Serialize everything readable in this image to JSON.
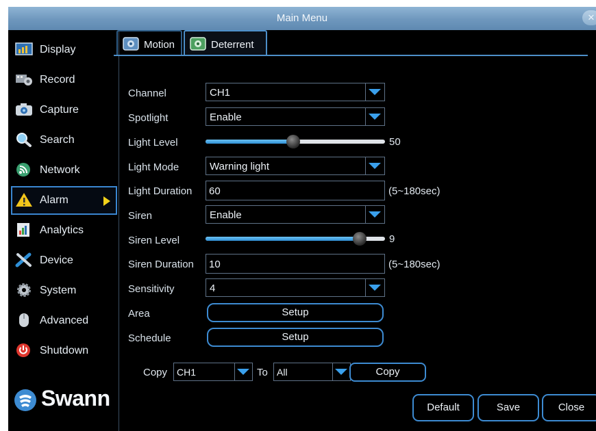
{
  "window": {
    "title": "Main Menu",
    "close_icon": "close-icon"
  },
  "sidebar": {
    "items": [
      {
        "label": "Display",
        "icon": "display-icon"
      },
      {
        "label": "Record",
        "icon": "record-icon"
      },
      {
        "label": "Capture",
        "icon": "camera-icon"
      },
      {
        "label": "Search",
        "icon": "search-icon"
      },
      {
        "label": "Network",
        "icon": "network-icon"
      },
      {
        "label": "Alarm",
        "icon": "warning-icon",
        "active": true
      },
      {
        "label": "Analytics",
        "icon": "analytics-icon"
      },
      {
        "label": "Device",
        "icon": "tools-icon"
      },
      {
        "label": "System",
        "icon": "gear-icon"
      },
      {
        "label": "Advanced",
        "icon": "mouse-icon"
      },
      {
        "label": "Shutdown",
        "icon": "power-icon"
      }
    ],
    "logo": "Swann"
  },
  "tabs": [
    {
      "label": "Motion",
      "icon": "motion-camera-icon"
    },
    {
      "label": "Deterrent",
      "icon": "deterrent-camera-icon",
      "active": true
    }
  ],
  "form": {
    "channel": {
      "label": "Channel",
      "value": "CH1"
    },
    "spotlight": {
      "label": "Spotlight",
      "value": "Enable"
    },
    "light_level": {
      "label": "Light Level",
      "value": "50",
      "fraction": 0.49
    },
    "light_mode": {
      "label": "Light Mode",
      "value": "Warning light"
    },
    "light_duration": {
      "label": "Light Duration",
      "value": "60",
      "hint": "(5~180sec)"
    },
    "siren": {
      "label": "Siren",
      "value": "Enable"
    },
    "siren_level": {
      "label": "Siren Level",
      "value": "9",
      "fraction": 0.86
    },
    "siren_duration": {
      "label": "Siren Duration",
      "value": "10",
      "hint": "(5~180sec)"
    },
    "sensitivity": {
      "label": "Sensitivity",
      "value": "4"
    },
    "area": {
      "label": "Area",
      "button": "Setup"
    },
    "schedule": {
      "label": "Schedule",
      "button": "Setup"
    }
  },
  "copy": {
    "label": "Copy",
    "from": "CH1",
    "to_label": "To",
    "to": "All",
    "button": "Copy"
  },
  "footer": {
    "default": "Default",
    "save": "Save",
    "close": "Close"
  },
  "colors": {
    "accent": "#3d8bd2",
    "dropdown_arrow": "#3aa0ec",
    "active_arrow": "#f2d21a",
    "background": "#000000"
  }
}
